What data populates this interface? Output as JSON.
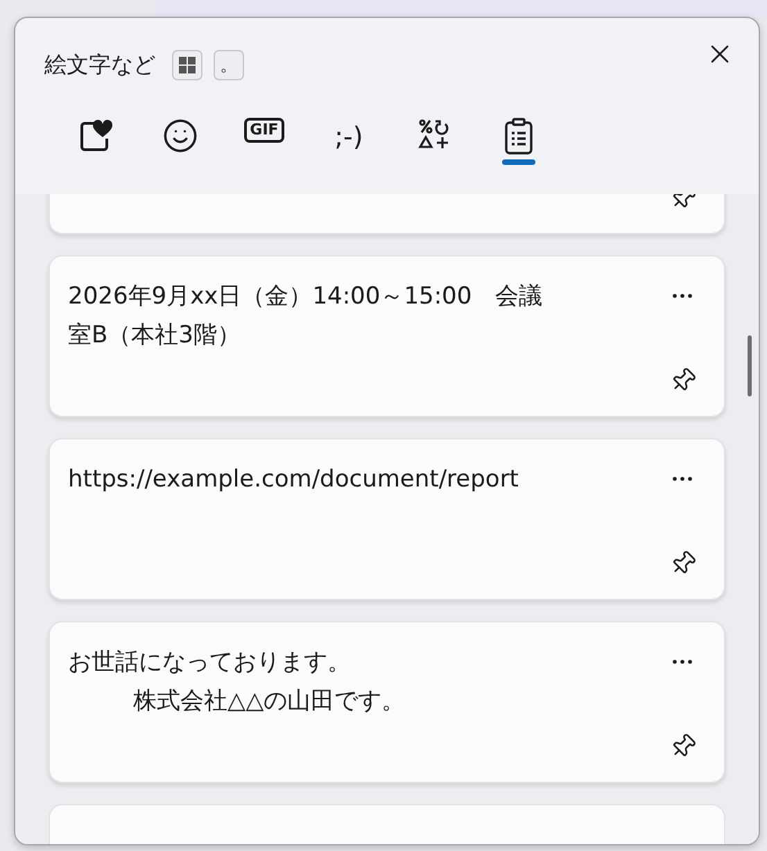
{
  "panel": {
    "title": "絵文字など",
    "mode_buttons": [
      {
        "kind": "grid"
      },
      {
        "kind": "text",
        "label": "。"
      }
    ]
  },
  "tabs": [
    {
      "kind": "favorites",
      "selected": false
    },
    {
      "kind": "emoji",
      "selected": false
    },
    {
      "kind": "gif",
      "label": "GIF",
      "selected": false
    },
    {
      "kind": "kaomoji",
      "label": ";-)",
      "selected": false
    },
    {
      "kind": "symbols",
      "selected": false
    },
    {
      "kind": "clipboard",
      "selected": true
    }
  ],
  "clipboard_items": [
    {
      "pinned": false
    },
    {
      "lines": [
        {
          "text": "2026年9月xx日（金）14:00～15:00　会議室B（本社3階）",
          "indented": false
        }
      ],
      "pinned": false
    },
    {
      "lines": [
        {
          "text": "https://example.com/document/report",
          "indented": false
        }
      ],
      "pinned": false
    },
    {
      "lines": [
        {
          "text": "お世話になっております。",
          "indented": false
        },
        {
          "text": "株式会社△△の山田です。",
          "indented": true
        }
      ],
      "pinned": false
    },
    {
      "kind": "cut_off"
    }
  ]
}
